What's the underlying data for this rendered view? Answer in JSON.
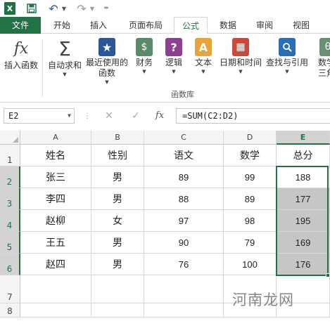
{
  "qat": {
    "logo_letter": "X",
    "icons": [
      "excel-logo",
      "save-icon",
      "undo-icon",
      "redo-icon",
      "customize-qat-icon"
    ]
  },
  "tabs": [
    "文件",
    "开始",
    "插入",
    "页面布局",
    "公式",
    "数据",
    "审阅",
    "视图"
  ],
  "active_tab": "公式",
  "ribbon": {
    "buttons": [
      {
        "label": "插入函数",
        "icon": "fx-icon",
        "symbol": "fx"
      },
      {
        "label": "自动求和",
        "icon": "sigma-icon",
        "symbol": "Σ"
      },
      {
        "label": "最近使用的\n函数",
        "icon": "star-icon",
        "symbol": "★"
      },
      {
        "label": "财务",
        "icon": "coins-icon",
        "symbol": "$"
      },
      {
        "label": "逻辑",
        "icon": "question-icon",
        "symbol": "?"
      },
      {
        "label": "文本",
        "icon": "text-icon",
        "symbol": "A"
      },
      {
        "label": "日期和时间",
        "icon": "calendar-icon",
        "symbol": "▦"
      },
      {
        "label": "查找与引用",
        "icon": "lookup-icon",
        "symbol": "🔍"
      },
      {
        "label": "数学\n三角",
        "icon": "math-icon",
        "symbol": "θ"
      }
    ],
    "group_label": "函数库",
    "colors": {
      "fx": "#444444",
      "sigma": "#444444",
      "star": "#2b5797",
      "coins": "#5b8a6a",
      "question": "#8e3f8f",
      "text": "#e8a43c",
      "calendar": "#c94a3c",
      "lookup": "#2a6fb5"
    }
  },
  "formula_bar": {
    "name_box": "E2",
    "cancel": "✕",
    "enter": "✓",
    "fx": "fx",
    "formula": "=SUM(C2:D2)"
  },
  "grid": {
    "columns": [
      "A",
      "B",
      "C",
      "D",
      "E"
    ],
    "selected_column": "E",
    "row_numbers": [
      "1",
      "2",
      "3",
      "4",
      "5",
      "6",
      "7",
      "8"
    ],
    "header_row": [
      "姓名",
      "性别",
      "语文",
      "数学",
      "总分"
    ],
    "rows": [
      [
        "张三",
        "男",
        "89",
        "99",
        "188"
      ],
      [
        "李四",
        "男",
        "88",
        "89",
        "177"
      ],
      [
        "赵柳",
        "女",
        "97",
        "98",
        "195"
      ],
      [
        "王五",
        "男",
        "90",
        "79",
        "169"
      ],
      [
        "赵四",
        "男",
        "76",
        "100",
        "176"
      ]
    ]
  },
  "watermark": "河南龙网",
  "accent_color": "#217346"
}
